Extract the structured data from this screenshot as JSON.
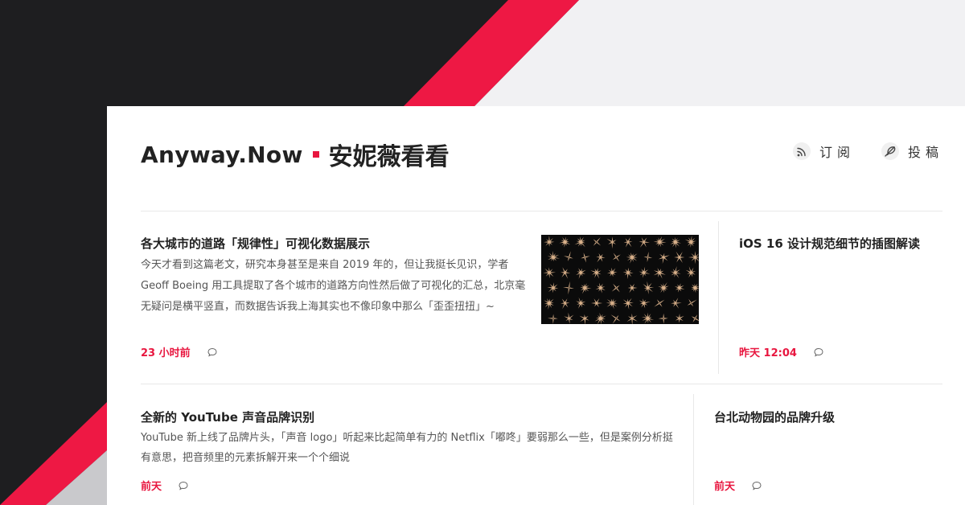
{
  "colors": {
    "accent": "#e8163f",
    "dark": "#1e1e20",
    "light": "#f1f1f3"
  },
  "brand": {
    "name_en": "Anyway.Now",
    "name_zh": "安妮薇看看"
  },
  "header": {
    "rss": {
      "icon": "rss-icon",
      "label": "订阅"
    },
    "submit": {
      "icon": "feather-icon",
      "label": "投稿"
    }
  },
  "articles": [
    {
      "title": "各大城市的道路「规律性」可视化数据展示",
      "excerpt": "今天才看到这篇老文，研究本身甚至是来自 2019 年的，但让我挺长见识，学者 Geoff Boeing 用工具提取了各个城市的道路方向性然后做了可视化的汇总，北京毫无疑问是横平竖直，而数据告诉我上海其实也不像印象中那么「歪歪扭扭」~",
      "time": "23 小时前",
      "comment_icon": "comment-icon",
      "thumbnail": "city-street-orientation-polar-plots"
    },
    {
      "title": "iOS 16 设计规范细节的插图解读",
      "time": "昨天 12:04",
      "comment_icon": "comment-icon"
    },
    {
      "title": "全新的 YouTube 声音品牌识别",
      "excerpt": "YouTube 新上线了品牌片头，「声音 logo」听起来比起简单有力的 Netflix「嘟咚」要弱那么一些，但是案例分析挺有意思，把音频里的元素拆解开来一个个细说",
      "time": "前天",
      "comment_icon": "comment-icon"
    },
    {
      "title": "台北动物园的品牌升级",
      "time": "前天",
      "comment_icon": "comment-icon"
    }
  ]
}
